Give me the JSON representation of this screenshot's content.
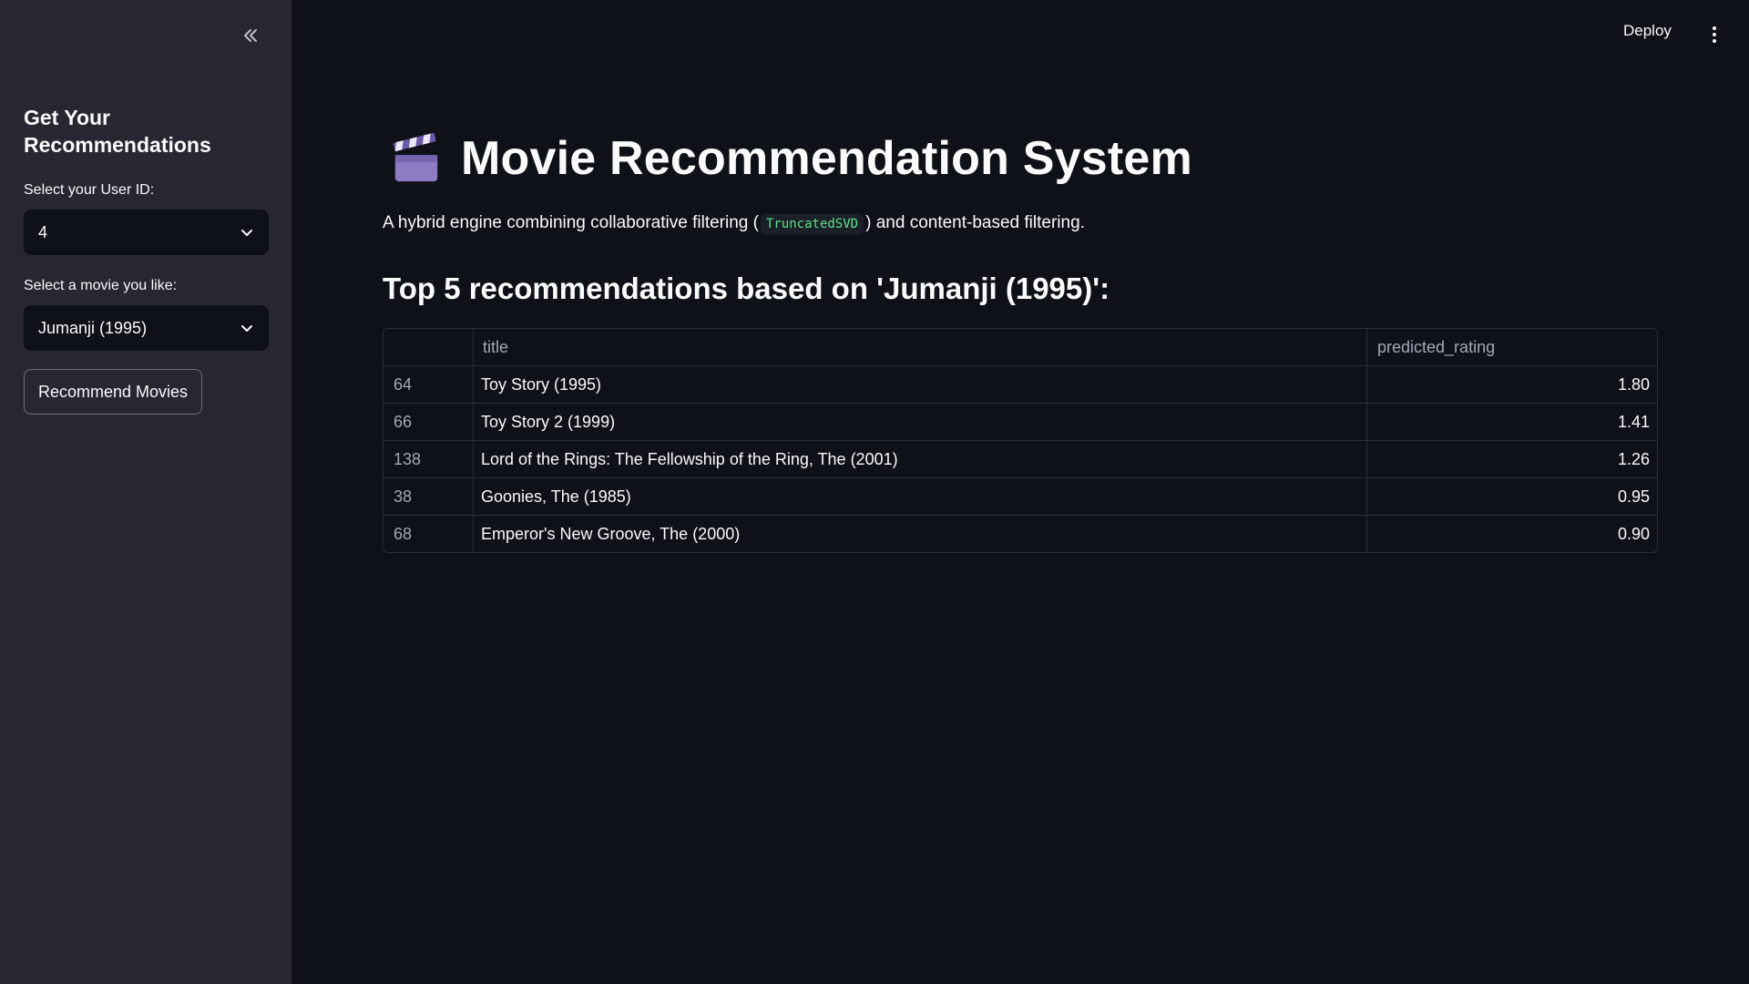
{
  "sidebar": {
    "title": "Get Your Recommendations",
    "user_label": "Select your User ID:",
    "user_value": "4",
    "movie_label": "Select a movie you like:",
    "movie_value": "Jumanji (1995)",
    "button_label": "Recommend Movies"
  },
  "header": {
    "deploy_label": "Deploy"
  },
  "main": {
    "title": "Movie Recommendation System",
    "subtitle_before": "A hybrid engine combining collaborative filtering (",
    "subtitle_code": "TruncatedSVD",
    "subtitle_after": ") and content-based filtering.",
    "section_heading": "Top 5 recommendations based on 'Jumanji (1995)':"
  },
  "table": {
    "columns": [
      "",
      "title",
      "predicted_rating"
    ],
    "rows": [
      {
        "index": "64",
        "title": "Toy Story (1995)",
        "rating": "1.80"
      },
      {
        "index": "66",
        "title": "Toy Story 2 (1999)",
        "rating": "1.41"
      },
      {
        "index": "138",
        "title": "Lord of the Rings: The Fellowship of the Ring, The (2001)",
        "rating": "1.26"
      },
      {
        "index": "38",
        "title": "Goonies, The (1985)",
        "rating": "0.95"
      },
      {
        "index": "68",
        "title": "Emperor's New Groove, The (2000)",
        "rating": "0.90"
      }
    ]
  },
  "colors": {
    "background": "#0e1117",
    "sidebar": "#262730",
    "code_text": "#5ce488"
  }
}
